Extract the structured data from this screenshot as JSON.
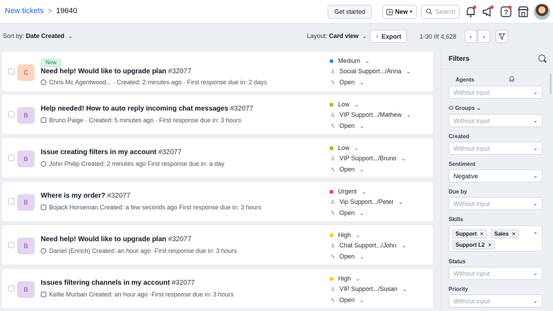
{
  "header": {
    "breadcrumb_link": "New tickets",
    "breadcrumb_sep": ">",
    "breadcrumb_current": "19640",
    "get_started_label": "Get started",
    "new_label": "New",
    "search_placeholder": "Search"
  },
  "toolbar": {
    "sort_prefix": "Sort by:",
    "sort_value": "Date Created",
    "layout_prefix": "Layout:",
    "layout_value": "Card view",
    "export_label": "Export",
    "range": "1-30 0f 4,628"
  },
  "tickets": [
    {
      "initial": "C",
      "color": "orange",
      "badge": "New",
      "title": "Need help! Would like to upgrade plan",
      "id": "#32077",
      "meta": "Chris Mc Agentwood...  · Created: 2 minutes ago  · First response due in: 2 days",
      "priority": "Medium",
      "priority_color": "#3b82f6",
      "group": "Social Support.../Anna",
      "status": "Open"
    },
    {
      "initial": "B",
      "color": "purple",
      "badge": "",
      "title": "Help needed! How to auto reply incoming chat messages",
      "id": "#32077",
      "meta": "Bruno Paige · Created: 5 minutes ago · First response due in: 3 hours",
      "priority": "Low",
      "priority_color": "#84cc16",
      "group": "VIP Support.../Mathew",
      "status": "Open"
    },
    {
      "initial": "B",
      "color": "purple",
      "badge": "",
      "title": "Issue creating filters in my account",
      "id": "#32077",
      "meta": "John Philip   Created: 2 minutes ago   First response due in: a day",
      "priority": "Low",
      "priority_color": "#84cc16",
      "group": "VIP Support.../Bruno",
      "status": "Open"
    },
    {
      "initial": "B",
      "color": "purple",
      "badge": "",
      "title": "Where is my order?",
      "id": "#32077",
      "meta": "Bojack Horseman   Created: a few seconds ago   First response due in: 3 hours",
      "priority": "Urgent",
      "priority_color": "#ef4444",
      "group": "Vip Support.../Peter",
      "status": "Open"
    },
    {
      "initial": "B",
      "color": "purple",
      "badge": "",
      "title": "Need help! Would like to upgrade plan",
      "id": "#32077",
      "meta": "Daniel (Enrich)   Created: an hour ago   ·First response due in: 3 hours",
      "priority": "High",
      "priority_color": "#facc15",
      "group": "Chat Support.../John",
      "status": "Open"
    },
    {
      "initial": "B",
      "color": "purple",
      "badge": "",
      "title": "Issues filtering channels in my account",
      "id": "#32077",
      "meta": "Kellie Murban   Created: an hour ago   ·First response due in: 3 hours",
      "priority": "High",
      "priority_color": "#facc15",
      "group": "VIP Support.../Susan",
      "status": "Open"
    }
  ],
  "filters": {
    "title": "Filters",
    "agents_label": "Agents",
    "groups_label": "Groups",
    "created_label": "Created",
    "sentiment_label": "Sentiment",
    "due_by_label": "Due by",
    "skills_label": "Skills",
    "status_label": "Status",
    "priority_label": "Priority",
    "placeholder": "Without input",
    "sentiment_value": "Negative",
    "skills_tags": [
      "Support",
      "Sales",
      "Support L2"
    ],
    "tag_remove": "×"
  }
}
